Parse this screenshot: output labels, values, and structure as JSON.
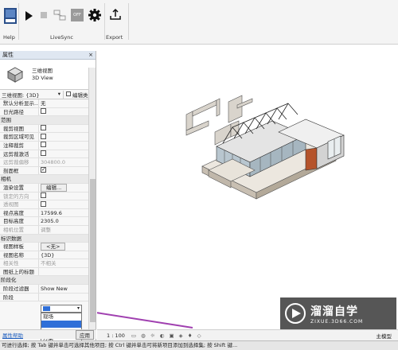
{
  "ribbon": {
    "groups": [
      {
        "label": "Help"
      },
      {
        "label": "LiveSync"
      },
      {
        "label": "Export"
      }
    ],
    "icons": [
      "revit-logo-icon",
      "play-icon",
      "stop-icon",
      "link-icon",
      "off-toggle-icon",
      "gear-icon",
      "export-icon"
    ],
    "off_label": "OFF"
  },
  "properties": {
    "title": "属性",
    "close": "×",
    "type_name": "三维视图",
    "type_sub": "3D View",
    "selector_value": "三维视图: {3D}",
    "edit_type_label": "编辑类型",
    "rows": [
      {
        "kind": "prop",
        "key": "默认分析显示...",
        "value": "无"
      },
      {
        "kind": "prop",
        "key": "日光路径",
        "checkbox": false
      },
      {
        "kind": "section",
        "key": "范围"
      },
      {
        "kind": "prop",
        "key": "裁剪视图",
        "checkbox": false
      },
      {
        "kind": "prop",
        "key": "裁剪区域可见",
        "checkbox": false
      },
      {
        "kind": "prop",
        "key": "注释裁剪",
        "checkbox": false
      },
      {
        "kind": "prop",
        "key": "远剪裁激活",
        "checkbox": false
      },
      {
        "kind": "prop",
        "key": "远剪裁偏移",
        "value": "304800.0",
        "dim": true
      },
      {
        "kind": "prop",
        "key": "剖面框",
        "checkbox": true
      },
      {
        "kind": "section",
        "key": "相机"
      },
      {
        "kind": "prop",
        "key": "渲染设置",
        "button": "编辑..."
      },
      {
        "kind": "prop",
        "key": "锁定的方向",
        "checkbox": false,
        "dim": true
      },
      {
        "kind": "prop",
        "key": "透视图",
        "checkbox": false,
        "dim": true
      },
      {
        "kind": "prop",
        "key": "视点高度",
        "value": "17599.6"
      },
      {
        "kind": "prop",
        "key": "目标高度",
        "value": "2305.0"
      },
      {
        "kind": "prop",
        "key": "相机位置",
        "value": "调整",
        "dim": true
      },
      {
        "kind": "section",
        "key": "标识数据"
      },
      {
        "kind": "prop",
        "key": "视图样板",
        "button": "<无>"
      },
      {
        "kind": "prop",
        "key": "视图名称",
        "value": "{3D}"
      },
      {
        "kind": "prop",
        "key": "相关性",
        "value": "不相关",
        "dim": true
      },
      {
        "kind": "prop",
        "key": "图纸上的标题",
        "value": ""
      },
      {
        "kind": "section",
        "key": "阶段化"
      },
      {
        "kind": "prop",
        "key": "阶段过滤器",
        "value": "Show New"
      },
      {
        "kind": "prop",
        "key": "阶段",
        "value": ""
      }
    ],
    "phase_dropdown_options": [
      "现场",
      "",
      "",
      "方案"
    ],
    "help_link": "属性帮助",
    "apply_label": "应用"
  },
  "viewbar": {
    "scale": "1 : 100",
    "model": "主模型"
  },
  "statusbar": {
    "text": "可进行选择; 按 Tab 键并单击可选择其他项目; 按 Ctrl 键并单击可将新项目添加到选择集; 按 Shift 键..."
  },
  "watermark": {
    "title": "溜溜自学",
    "url": "ZIXUE.3D66.COM"
  },
  "colors": {
    "selection": "#2f6fd8",
    "arrow": "#a040b0",
    "panel_title": "#dfe7f1",
    "wall_red": "#b5532a"
  }
}
